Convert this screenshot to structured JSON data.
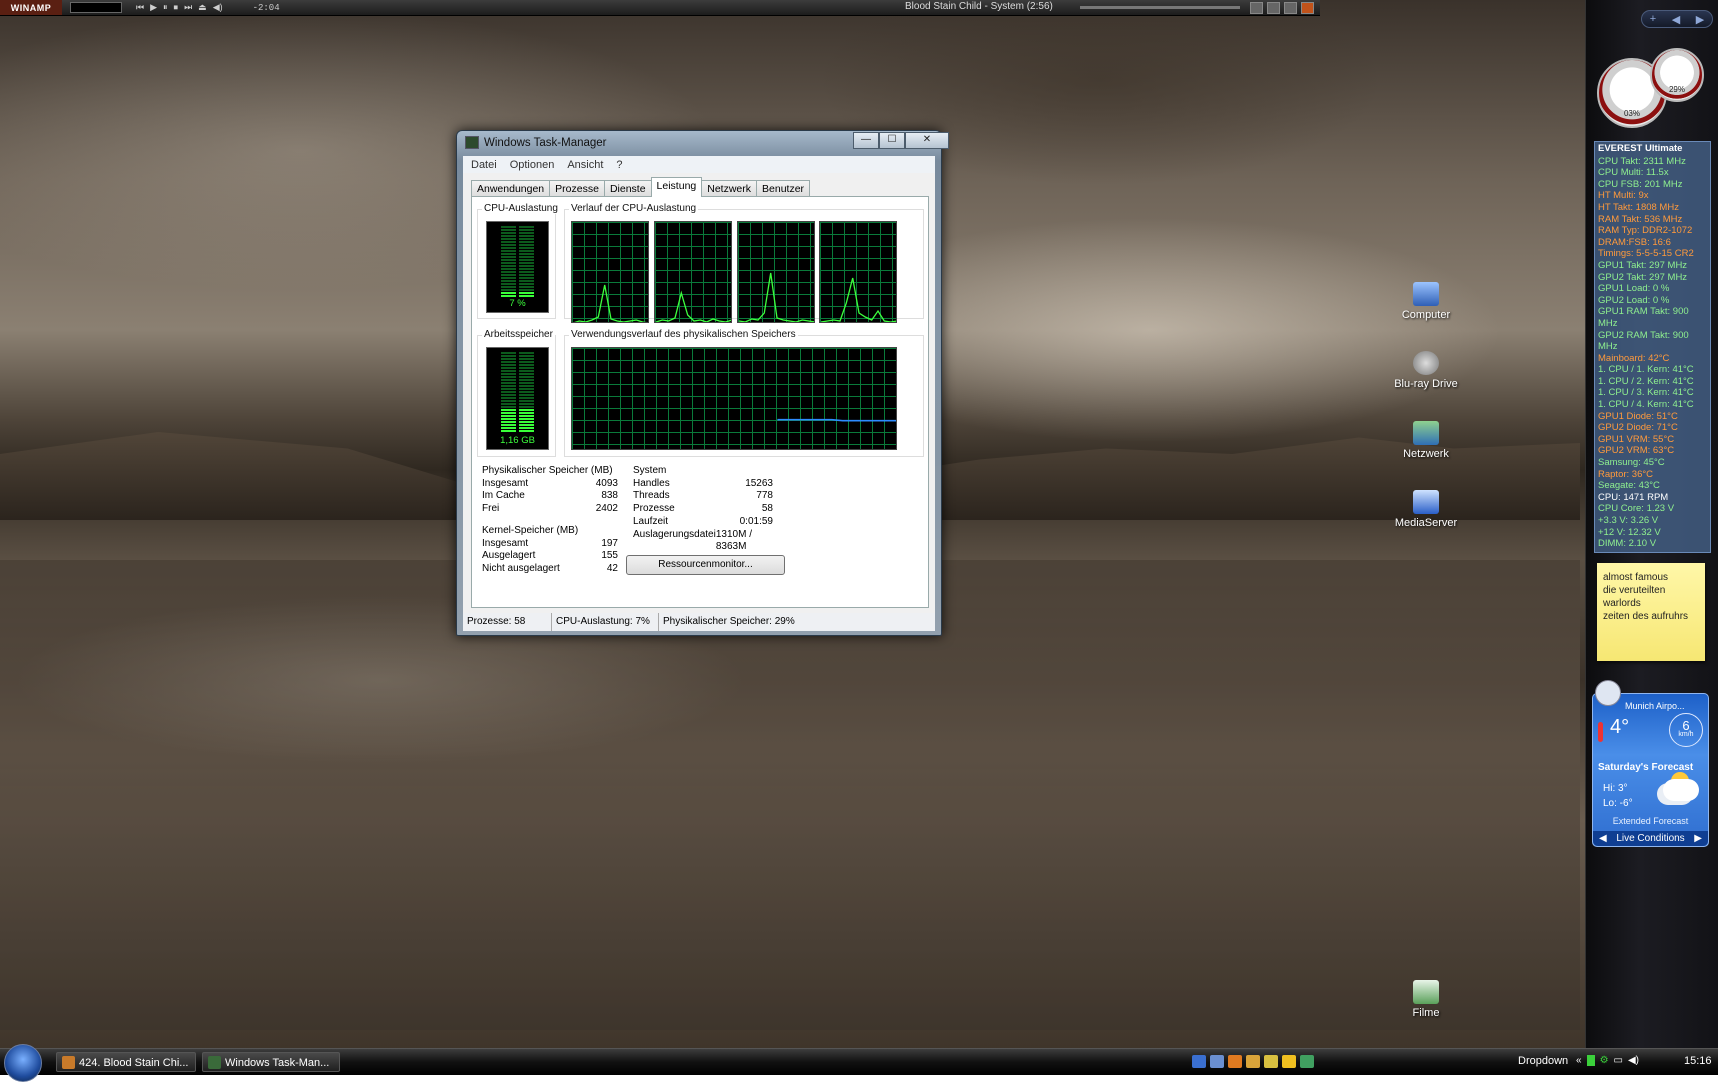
{
  "winamp": {
    "logo": "WINAMP",
    "controls": [
      "⏮",
      "▶",
      "⏸",
      "⏹",
      "⏭",
      "⏏",
      "◀)"
    ],
    "time": "-2:04",
    "song": "Blood Stain Child - System (2:56)"
  },
  "task_manager": {
    "title": "Windows Task-Manager",
    "caption": {
      "minimize": "—",
      "maximize": "☐",
      "close": "✕"
    },
    "menu": [
      "Datei",
      "Optionen",
      "Ansicht",
      "?"
    ],
    "tabs": [
      "Anwendungen",
      "Prozesse",
      "Dienste",
      "Leistung",
      "Netzwerk",
      "Benutzer"
    ],
    "active_tab": "Leistung",
    "cpu_usage_label": "CPU-Auslastung",
    "cpu_usage_value": "7 %",
    "cpu_history_label": "Verlauf der CPU-Auslastung",
    "memory_label": "Arbeitsspeicher",
    "memory_value": "1,16 GB",
    "memory_history_label": "Verwendungsverlauf des physikalischen Speichers",
    "physical_memory": {
      "heading": "Physikalischer Speicher (MB)",
      "rows": [
        {
          "label": "Insgesamt",
          "value": "4093"
        },
        {
          "label": "Im Cache",
          "value": "838"
        },
        {
          "label": "Frei",
          "value": "2402"
        }
      ]
    },
    "kernel_memory": {
      "heading": "Kernel-Speicher (MB)",
      "rows": [
        {
          "label": "Insgesamt",
          "value": "197"
        },
        {
          "label": "Ausgelagert",
          "value": "155"
        },
        {
          "label": "Nicht ausgelagert",
          "value": "42"
        }
      ]
    },
    "system": {
      "heading": "System",
      "rows": [
        {
          "label": "Handles",
          "value": "15263"
        },
        {
          "label": "Threads",
          "value": "778"
        },
        {
          "label": "Prozesse",
          "value": "58"
        },
        {
          "label": "Laufzeit",
          "value": "0:01:59"
        },
        {
          "label": "Auslagerungsdatei",
          "value": "1310M / 8363M"
        }
      ]
    },
    "resource_monitor_button": "Ressourcenmonitor...",
    "status": {
      "processes": "Prozesse: 58",
      "cpu": "CPU-Auslastung: 7%",
      "memory": "Physikalischer Speicher: 29%"
    }
  },
  "everest": {
    "title": "EVEREST Ultimate",
    "lines": [
      {
        "text": "CPU Takt: 2311 MHz",
        "color": "#8ff08f"
      },
      {
        "text": "CPU Multi: 11.5x",
        "color": "#8ff08f"
      },
      {
        "text": "CPU FSB: 201 MHz",
        "color": "#8ff08f"
      },
      {
        "text": "HT Multi: 9x",
        "color": "#ff9a3c"
      },
      {
        "text": "HT Takt: 1808 MHz",
        "color": "#ff9a3c"
      },
      {
        "text": "RAM Takt: 536 MHz",
        "color": "#ff9a3c"
      },
      {
        "text": "RAM Typ: DDR2-1072",
        "color": "#ff9a3c"
      },
      {
        "text": "DRAM:FSB: 16:6",
        "color": "#ff9a3c"
      },
      {
        "text": "Timings: 5-5-5-15 CR2",
        "color": "#ff9a3c"
      },
      {
        "text": "GPU1 Takt: 297 MHz",
        "color": "#8ff08f"
      },
      {
        "text": "GPU2 Takt: 297 MHz",
        "color": "#8ff08f"
      },
      {
        "text": "GPU1 Load: 0 %",
        "color": "#8ff08f"
      },
      {
        "text": "GPU2 Load: 0 %",
        "color": "#8ff08f"
      },
      {
        "text": "GPU1 RAM Takt: 900 MHz",
        "color": "#8ff08f"
      },
      {
        "text": "GPU2 RAM Takt: 900 MHz",
        "color": "#8ff08f"
      },
      {
        "text": "Mainboard: 42°C",
        "color": "#ff9a3c"
      },
      {
        "text": "1. CPU / 1. Kern: 41°C",
        "color": "#8ff08f"
      },
      {
        "text": "1. CPU / 2. Kern: 41°C",
        "color": "#8ff08f"
      },
      {
        "text": "1. CPU / 3. Kern: 41°C",
        "color": "#8ff08f"
      },
      {
        "text": "1. CPU / 4. Kern: 41°C",
        "color": "#8ff08f"
      },
      {
        "text": "GPU1 Diode: 51°C",
        "color": "#ff9a3c"
      },
      {
        "text": "GPU2 Diode: 71°C",
        "color": "#ff9a3c"
      },
      {
        "text": "GPU1 VRM: 55°C",
        "color": "#ff9a3c"
      },
      {
        "text": "GPU2 VRM: 63°C",
        "color": "#ff9a3c"
      },
      {
        "text": "Samsung: 45°C",
        "color": "#8ff08f"
      },
      {
        "text": "Raptor: 36°C",
        "color": "#ff9a3c"
      },
      {
        "text": "Seagate: 43°C",
        "color": "#8ff08f"
      },
      {
        "text": "CPU: 1471 RPM",
        "color": "#ffffff"
      },
      {
        "text": "CPU Core: 1.23 V",
        "color": "#8ff08f"
      },
      {
        "text": "+3.3 V: 3.26 V",
        "color": "#8ff08f"
      },
      {
        "text": "+12 V: 12.32 V",
        "color": "#8ff08f"
      },
      {
        "text": "DIMM: 2.10 V",
        "color": "#8ff08f"
      }
    ]
  },
  "gauges": {
    "cpu_value": "03%",
    "mem_value": "29%"
  },
  "sidebar_head": [
    "+",
    "◀",
    "▶"
  ],
  "note": {
    "lines": [
      "almost famous",
      "die veruteilten",
      "warlords",
      "zeiten des aufruhrs"
    ]
  },
  "weather": {
    "city": "Munich Airpo...",
    "temp": "4°",
    "wind": "6",
    "wind_unit": "km/h",
    "forecast_title": "Saturday's Forecast",
    "hi": "Hi: 3°",
    "lo": "Lo: -6°",
    "extended": "Extended Forecast",
    "live": "Live Conditions"
  },
  "desktop_icons": [
    {
      "label": "Computer"
    },
    {
      "label": "Blu-ray Drive"
    },
    {
      "label": "Netzwerk"
    },
    {
      "label": "MediaServer"
    },
    {
      "label": "Filme"
    }
  ],
  "taskbar": {
    "buttons": [
      "424. Blood Stain Chi...",
      "Windows Task-Man..."
    ],
    "dropdown": "Dropdown",
    "clock": "15:16"
  },
  "chart_data": [
    {
      "type": "line",
      "title": "Verlauf der CPU-Auslastung",
      "series": [
        {
          "values": [
            0,
            2,
            1,
            3,
            6,
            38,
            4,
            2,
            1,
            2,
            3,
            1,
            0
          ]
        }
      ]
    },
    {
      "type": "line",
      "series": [
        {
          "values": [
            1,
            3,
            2,
            5,
            30,
            8,
            2,
            3,
            1,
            4,
            2,
            1,
            3
          ]
        }
      ]
    },
    {
      "type": "line",
      "series": [
        {
          "values": [
            2,
            1,
            4,
            3,
            10,
            50,
            5,
            3,
            2,
            1,
            3,
            2,
            1
          ]
        }
      ]
    },
    {
      "type": "line",
      "series": [
        {
          "values": [
            1,
            2,
            3,
            2,
            20,
            45,
            10,
            6,
            3,
            12,
            2,
            1,
            2
          ]
        }
      ]
    },
    {
      "type": "line",
      "title": "Verwendungsverlauf des physikalischen Speichers",
      "series": [
        {
          "values": [
            30,
            30,
            30,
            30,
            30,
            30,
            29,
            29,
            29,
            29,
            29,
            29
          ]
        }
      ]
    }
  ]
}
